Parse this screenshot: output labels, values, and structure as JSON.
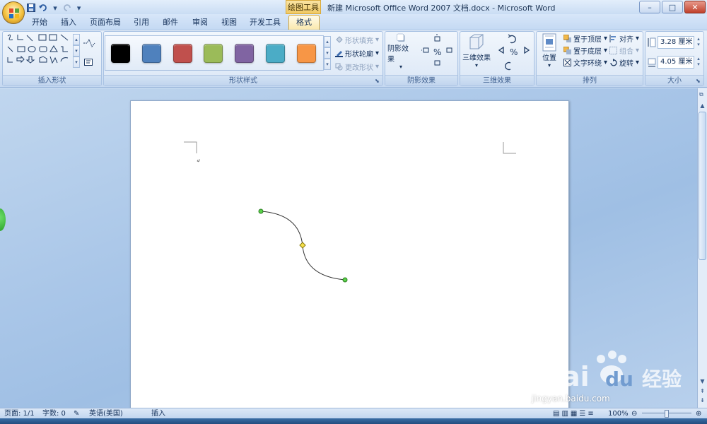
{
  "window": {
    "title": "新建 Microsoft Office Word 2007 文档.docx - Microsoft Word",
    "context_tab_title": "绘图工具",
    "controls": {
      "minimize": "–",
      "maximize": "□",
      "close": "✕"
    }
  },
  "qat": {
    "save_icon": "save-icon",
    "undo_icon": "undo-icon",
    "redo_icon": "redo-icon",
    "menu_arrow": "▾"
  },
  "tabs": [
    "开始",
    "插入",
    "页面布局",
    "引用",
    "邮件",
    "审阅",
    "视图",
    "开发工具",
    "格式"
  ],
  "active_tab": "格式",
  "ribbon": {
    "insert_shapes": {
      "label": "插入形状"
    },
    "shape_styles": {
      "label": "形状样式",
      "swatches": [
        "#000000",
        "#4f81bd",
        "#c0504d",
        "#9bbb59",
        "#8064a2",
        "#4bacc6",
        "#f79646"
      ],
      "fill": "形状填充",
      "outline": "形状轮廓",
      "change": "更改形状"
    },
    "shadow": {
      "label": "阴影效果",
      "button": "阴影效果"
    },
    "three_d": {
      "label": "三维效果",
      "button": "三维效果"
    },
    "arrange": {
      "label": "排列",
      "position": "位置",
      "bring_front": "置于顶层",
      "send_back": "置于底层",
      "wrap": "文字环绕",
      "align": "对齐",
      "group": "组合",
      "rotate": "旋转"
    },
    "size": {
      "label": "大小",
      "height": "3.28 厘米",
      "width": "4.05 厘米"
    }
  },
  "status": {
    "page": "页面: 1/1",
    "words": "字数: 0",
    "language": "英语(美国)",
    "mode": "插入",
    "zoom": "100%"
  },
  "watermark": {
    "logo": "Bai du 经验",
    "url": "jingyan.baidu.com"
  }
}
